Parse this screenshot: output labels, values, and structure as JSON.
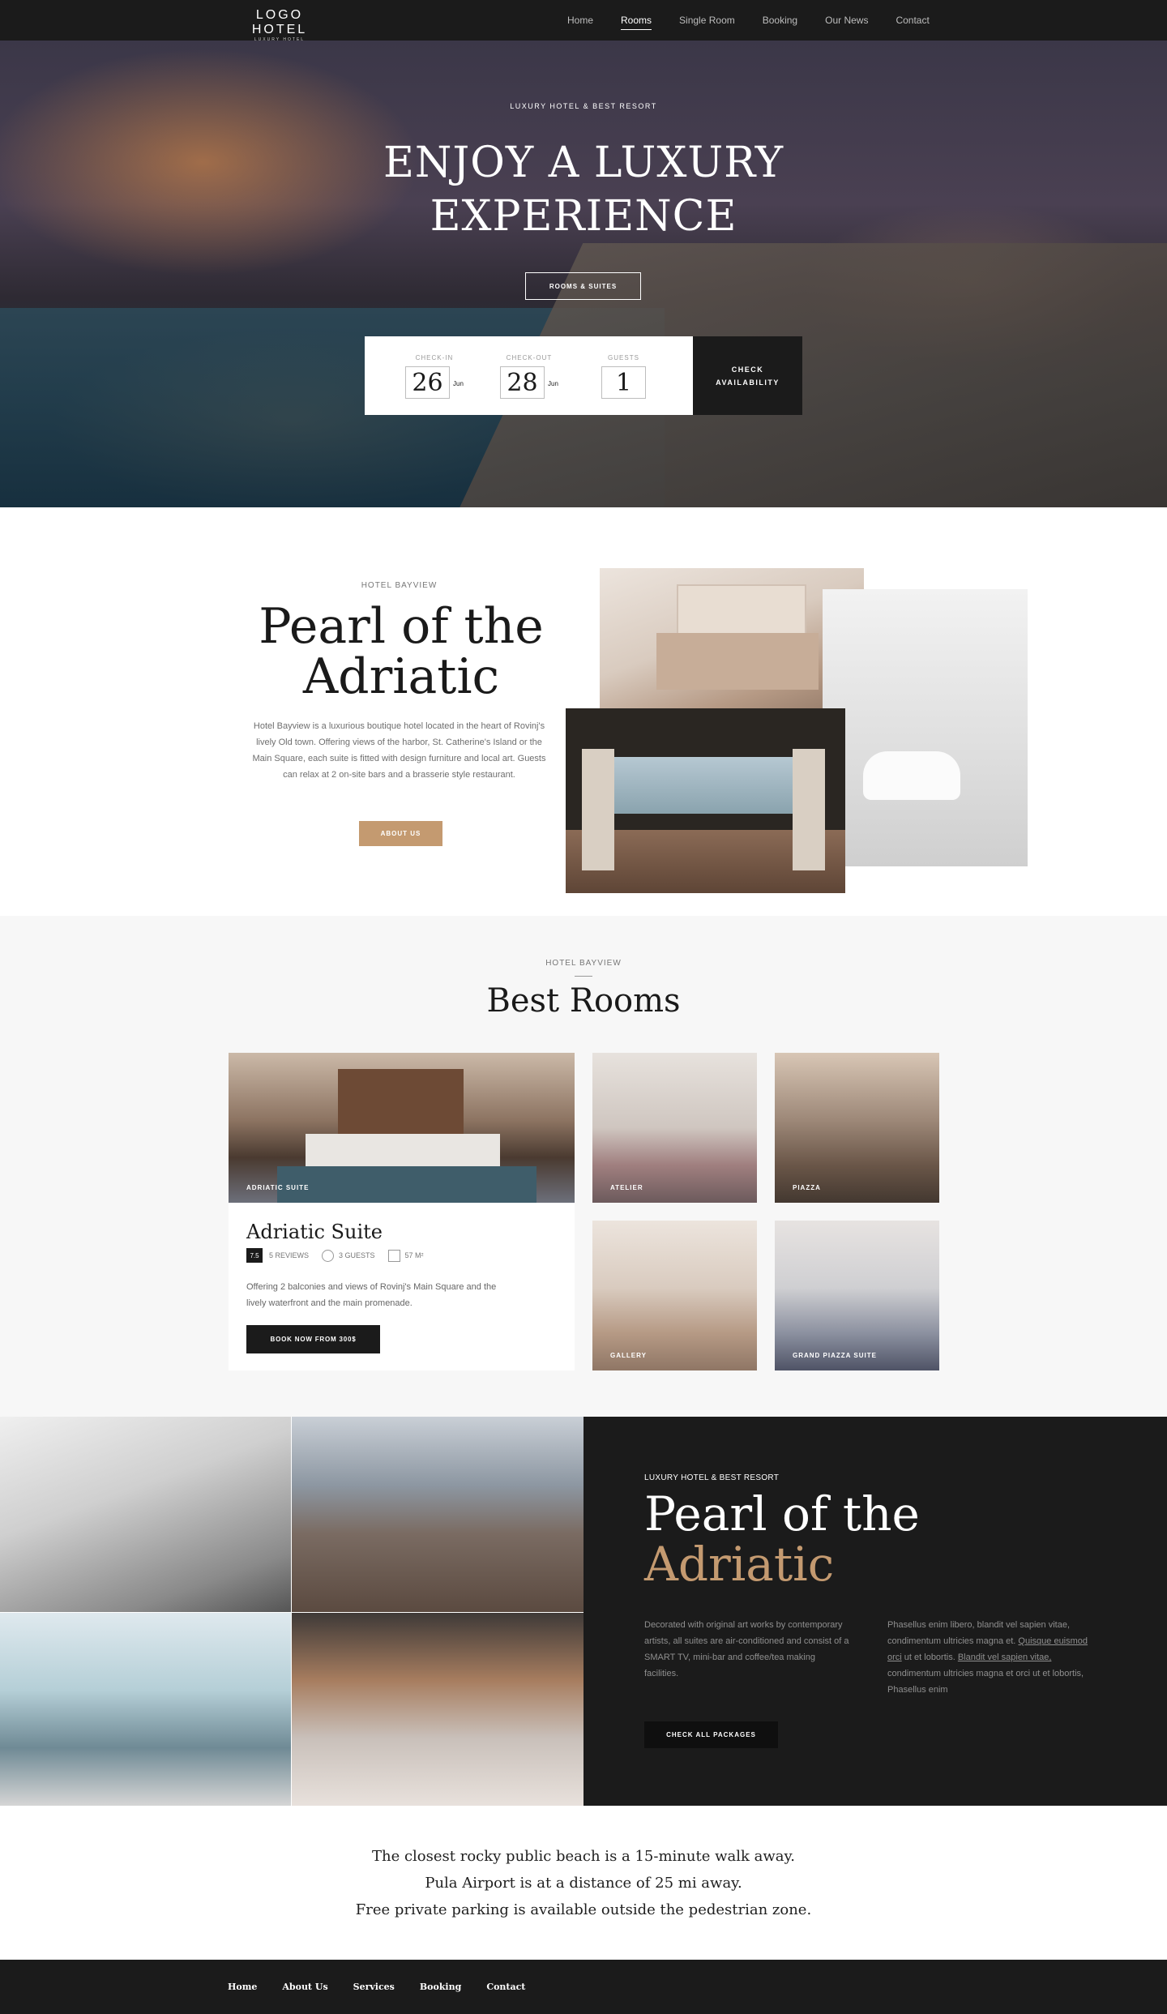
{
  "header": {
    "logo_main": "LOGO HOTEL",
    "logo_sub": "LUXURY HOTEL",
    "nav": [
      "Home",
      "Rooms",
      "Single Room",
      "Booking",
      "Our News",
      "Contact"
    ],
    "active_nav": "Rooms"
  },
  "hero": {
    "kicker": "LUXURY HOTEL & BEST RESORT",
    "title_line1": "ENJOY A LUXURY",
    "title_line2": "EXPERIENCE",
    "button": "ROOMS & SUITES"
  },
  "booking": {
    "checkin_label": "CHECK-IN",
    "checkin_day": "26",
    "checkin_month": "Jun",
    "checkout_label": "CHECK-OUT",
    "checkout_day": "28",
    "checkout_month": "Jun",
    "guests_label": "GUESTS",
    "guests_value": "1",
    "check_line1": "CHECK",
    "check_line2": "AVAILABILITY"
  },
  "about": {
    "kicker": "HOTEL BAYVIEW",
    "title_line1": "Pearl of the",
    "title_line2": "Adriatic",
    "text": "Hotel Bayview is a luxurious boutique hotel located in the heart of Rovinj's lively Old town. Offering views of the harbor, St. Catherine's Island or the Main Square, each suite is fitted with design furniture and local art. Guests can relax at 2 on-site bars and a brasserie style restaurant.",
    "button": "ABOUT US"
  },
  "rooms": {
    "kicker": "HOTEL BAYVIEW",
    "title": "Best Rooms",
    "featured": {
      "image_label": "ADRIATIC SUITE",
      "name": "Adriatic Suite",
      "score": "7.5",
      "reviews": "5 REVIEWS",
      "guests": "3 GUESTS",
      "size": "57 M²",
      "description": "Offering 2 balconies and views of Rovinj's Main Square and the lively waterfront and the main promenade.",
      "button": "BOOK NOW FROM 300$"
    },
    "thumbs": [
      "ATELIER",
      "PIAZZA",
      "GALLERY",
      "GRAND PIAZZA SUITE"
    ]
  },
  "packages": {
    "kicker": "LUXURY HOTEL & BEST RESORT",
    "title_line1": "Pearl of the",
    "title_line2": "Adriatic",
    "col1": "Decorated with original art works by contemporary artists, all suites are air-conditioned and consist of a SMART TV, mini-bar and coffee/tea making facilities.",
    "col2_a": "Phasellus enim libero, blandit vel sapien vitae, condimentum ultricies magna et.",
    "col2_link1": "Quisque euismod orci",
    "col2_b": "ut et lobortis.",
    "col2_link2": "Blandit vel sapien vitae,",
    "col2_c": "condimentum ultricies magna et orci ut et lobortis, Phasellus enim",
    "button": "CHECK ALL PACKAGES"
  },
  "info": {
    "line1": "The closest rocky public beach is a 15-minute walk away.",
    "line2": "Pula Airport is at a distance of 25 mi away.",
    "line3": "Free private parking is available outside the pedestrian zone."
  },
  "footer": {
    "nav": [
      "Home",
      "About Us",
      "Services",
      "Booking",
      "Contact"
    ]
  },
  "colors": {
    "dark": "#1b1b1b",
    "accent_gold": "#c49a70",
    "light_bg": "#f7f7f7"
  }
}
